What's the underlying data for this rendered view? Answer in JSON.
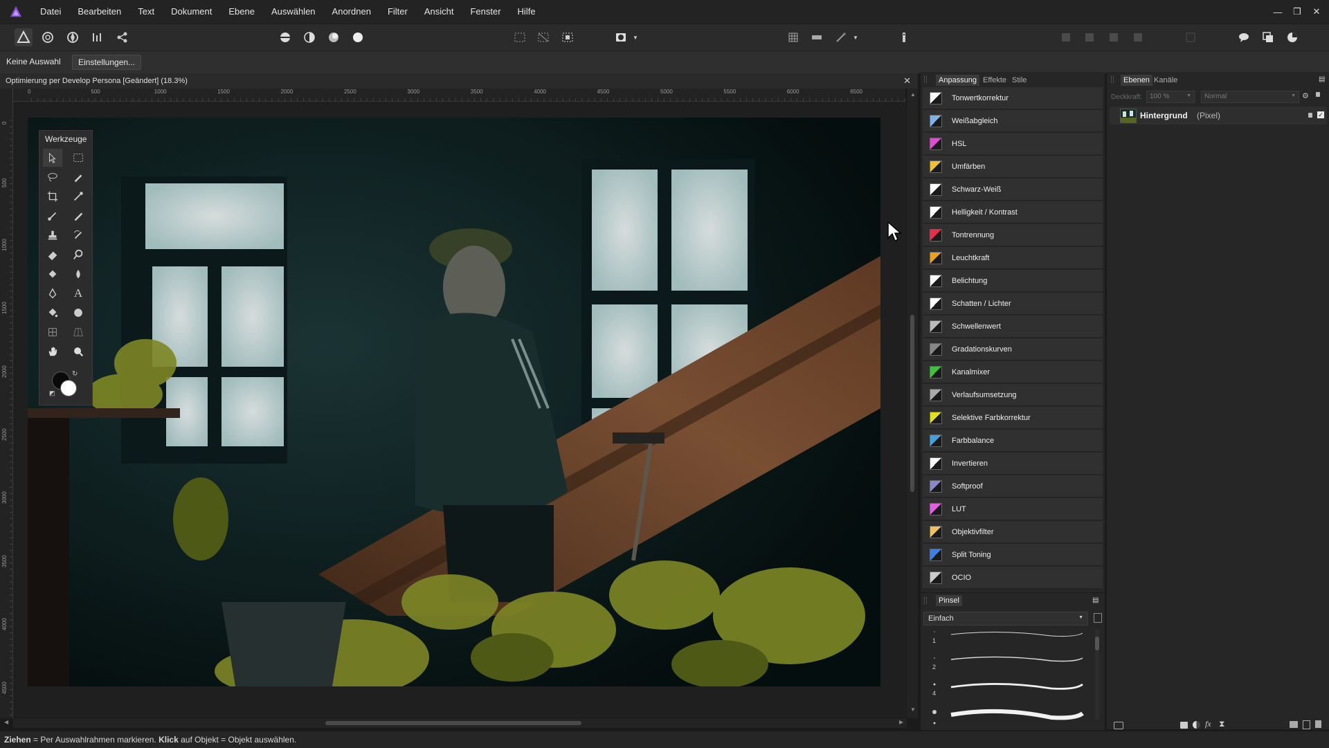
{
  "app": {
    "name": "Affinity Photo"
  },
  "menu": [
    "Datei",
    "Bearbeiten",
    "Text",
    "Dokument",
    "Ebene",
    "Auswählen",
    "Anordnen",
    "Filter",
    "Ansicht",
    "Fenster",
    "Hilfe"
  ],
  "context": {
    "selection": "Keine Auswahl",
    "settings_button": "Einstellungen..."
  },
  "document": {
    "title": "Optimierung per Develop Persona [Geändert] (18.3%)"
  },
  "ruler": {
    "unit": "px",
    "top_ticks": [
      "0",
      "500",
      "1000",
      "1500",
      "2000",
      "2500",
      "3000",
      "3500",
      "4000",
      "4500",
      "5000",
      "5500",
      "6000",
      "6500"
    ],
    "left_ticks": [
      "0",
      "500",
      "1000",
      "1500",
      "2000",
      "2500",
      "3000",
      "3500",
      "4000",
      "4500"
    ]
  },
  "tools_panel": {
    "title": "Werkzeuge"
  },
  "adjustment_panel": {
    "tabs": [
      "Anpassung",
      "Effekte",
      "Stile"
    ],
    "items": [
      {
        "label": "Tonwertkorrektur",
        "icon": "levels-icon",
        "color": "#ffffff"
      },
      {
        "label": "Weißabgleich",
        "icon": "white-balance-icon",
        "color": "#7fb0e8"
      },
      {
        "label": "HSL",
        "icon": "hsl-icon",
        "color": "#d84fd0"
      },
      {
        "label": "Umfärben",
        "icon": "recolor-icon",
        "color": "#f0c030"
      },
      {
        "label": "Schwarz-Weiß",
        "icon": "black-white-icon",
        "color": "#ffffff"
      },
      {
        "label": "Helligkeit / Kontrast",
        "icon": "brightness-contrast-icon",
        "color": "#ffffff"
      },
      {
        "label": "Tontrennung",
        "icon": "posterize-icon",
        "color": "#e0304a"
      },
      {
        "label": "Leuchtkraft",
        "icon": "vibrance-icon",
        "color": "#f0a020"
      },
      {
        "label": "Belichtung",
        "icon": "exposure-icon",
        "color": "#ffffff"
      },
      {
        "label": "Schatten / Lichter",
        "icon": "shadows-highlights-icon",
        "color": "#ffffff"
      },
      {
        "label": "Schwellenwert",
        "icon": "threshold-icon",
        "color": "#bbbbbb"
      },
      {
        "label": "Gradationskurven",
        "icon": "curves-icon",
        "color": "#888888"
      },
      {
        "label": "Kanalmixer",
        "icon": "channel-mixer-icon",
        "color": "#40c040"
      },
      {
        "label": "Verlaufsumsetzung",
        "icon": "gradient-map-icon",
        "color": "#aaaaaa"
      },
      {
        "label": "Selektive Farbkorrektur",
        "icon": "selective-color-icon",
        "color": "#e0e020"
      },
      {
        "label": "Farbbalance",
        "icon": "color-balance-icon",
        "color": "#40a0e0"
      },
      {
        "label": "Invertieren",
        "icon": "invert-icon",
        "color": "#ffffff"
      },
      {
        "label": "Softproof",
        "icon": "soft-proof-icon",
        "color": "#8888cc"
      },
      {
        "label": "LUT",
        "icon": "lut-icon",
        "color": "#e060e0"
      },
      {
        "label": "Objektivfilter",
        "icon": "lens-filter-icon",
        "color": "#f0c060"
      },
      {
        "label": "Split Toning",
        "icon": "split-toning-icon",
        "color": "#4080e0"
      },
      {
        "label": "OCIO",
        "icon": "ocio-icon",
        "color": "#cccccc"
      }
    ]
  },
  "brush_panel": {
    "title": "Pinsel",
    "category": "Einfach",
    "sizes": [
      "1",
      "2",
      "4"
    ]
  },
  "layers_panel": {
    "tabs": [
      "Ebenen",
      "Kanäle"
    ],
    "opacity_label": "Deckkraft:",
    "opacity": "100 %",
    "blend_mode": "Normal",
    "layers": [
      {
        "name": "Hintergrund",
        "type": "(Pixel)"
      }
    ]
  },
  "statusbar": {
    "bold1": "Ziehen",
    "text1": " = Per Auswahlrahmen markieren. ",
    "bold2": "Klick",
    "text2": " auf Objekt = Objekt auswählen."
  },
  "colors": {
    "accent": "#8a4fd8",
    "panel": "#262626",
    "row": "#303030"
  }
}
